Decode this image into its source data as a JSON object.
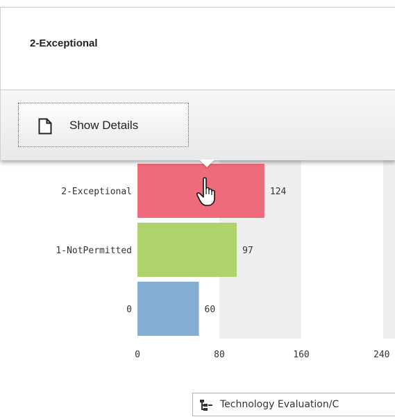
{
  "popup": {
    "title": "2-Exceptional",
    "show_details_label": "Show Details"
  },
  "dimension_chip": {
    "label": "Technology Evaluation/C",
    "icon": "hierarchy-icon"
  },
  "chart_data": {
    "type": "bar",
    "orientation": "horizontal",
    "categories": [
      "2-Exceptional",
      "1-NotPermitted",
      "0"
    ],
    "values": [
      124,
      97,
      60
    ],
    "colors": [
      "#ee6b7b",
      "#aed36d",
      "#85aed4"
    ],
    "x_ticks": [
      "0",
      "80",
      "160",
      "240"
    ],
    "xlim": [
      0,
      240
    ],
    "grid": "alternating-bands",
    "band_color": "#efefef",
    "highlighted_category": "2-Exceptional"
  }
}
